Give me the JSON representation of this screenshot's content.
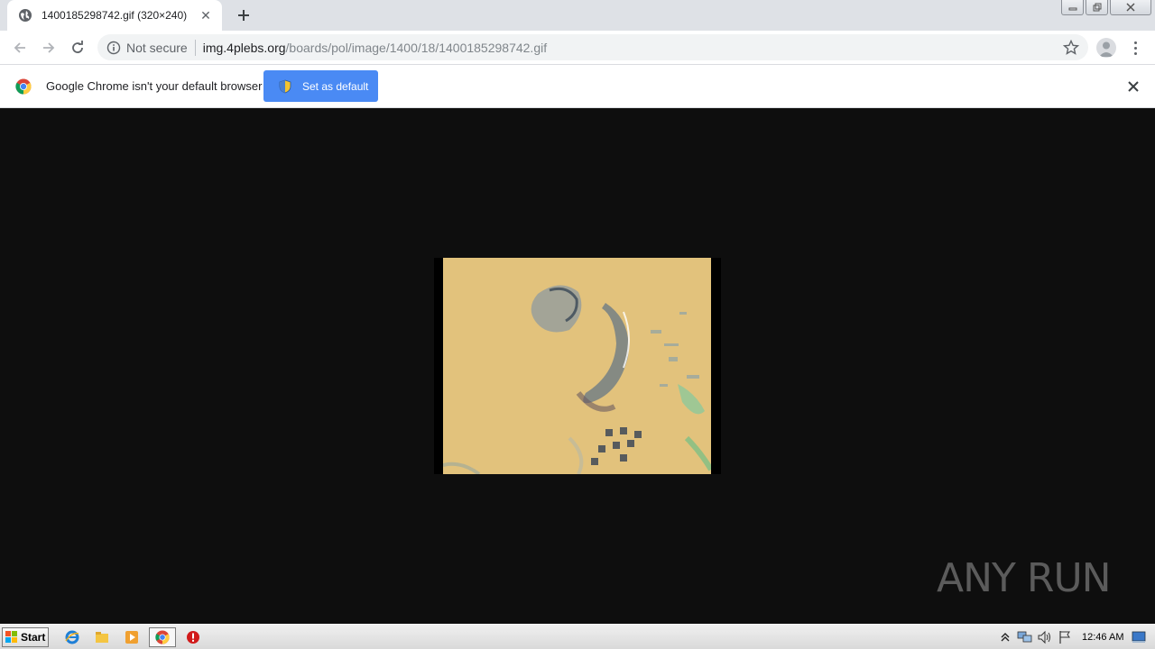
{
  "browser": {
    "tab": {
      "title": "1400185298742.gif (320×240)"
    },
    "toolbar": {
      "security_label": "Not secure",
      "url_host": "img.4plebs.org",
      "url_path": "/boards/pol/image/1400/18/1400185298742.gif"
    },
    "infobar": {
      "message": "Google Chrome isn't your default browser",
      "button_label": "Set as default"
    }
  },
  "content": {
    "watermark_text": "ANY RUN"
  },
  "taskbar": {
    "start_label": "Start",
    "clock": "12:46 AM"
  },
  "colors": {
    "accent": "#4a8af4",
    "viewport_bg": "#0e0e0e",
    "image_tone": "#e2c27c"
  }
}
